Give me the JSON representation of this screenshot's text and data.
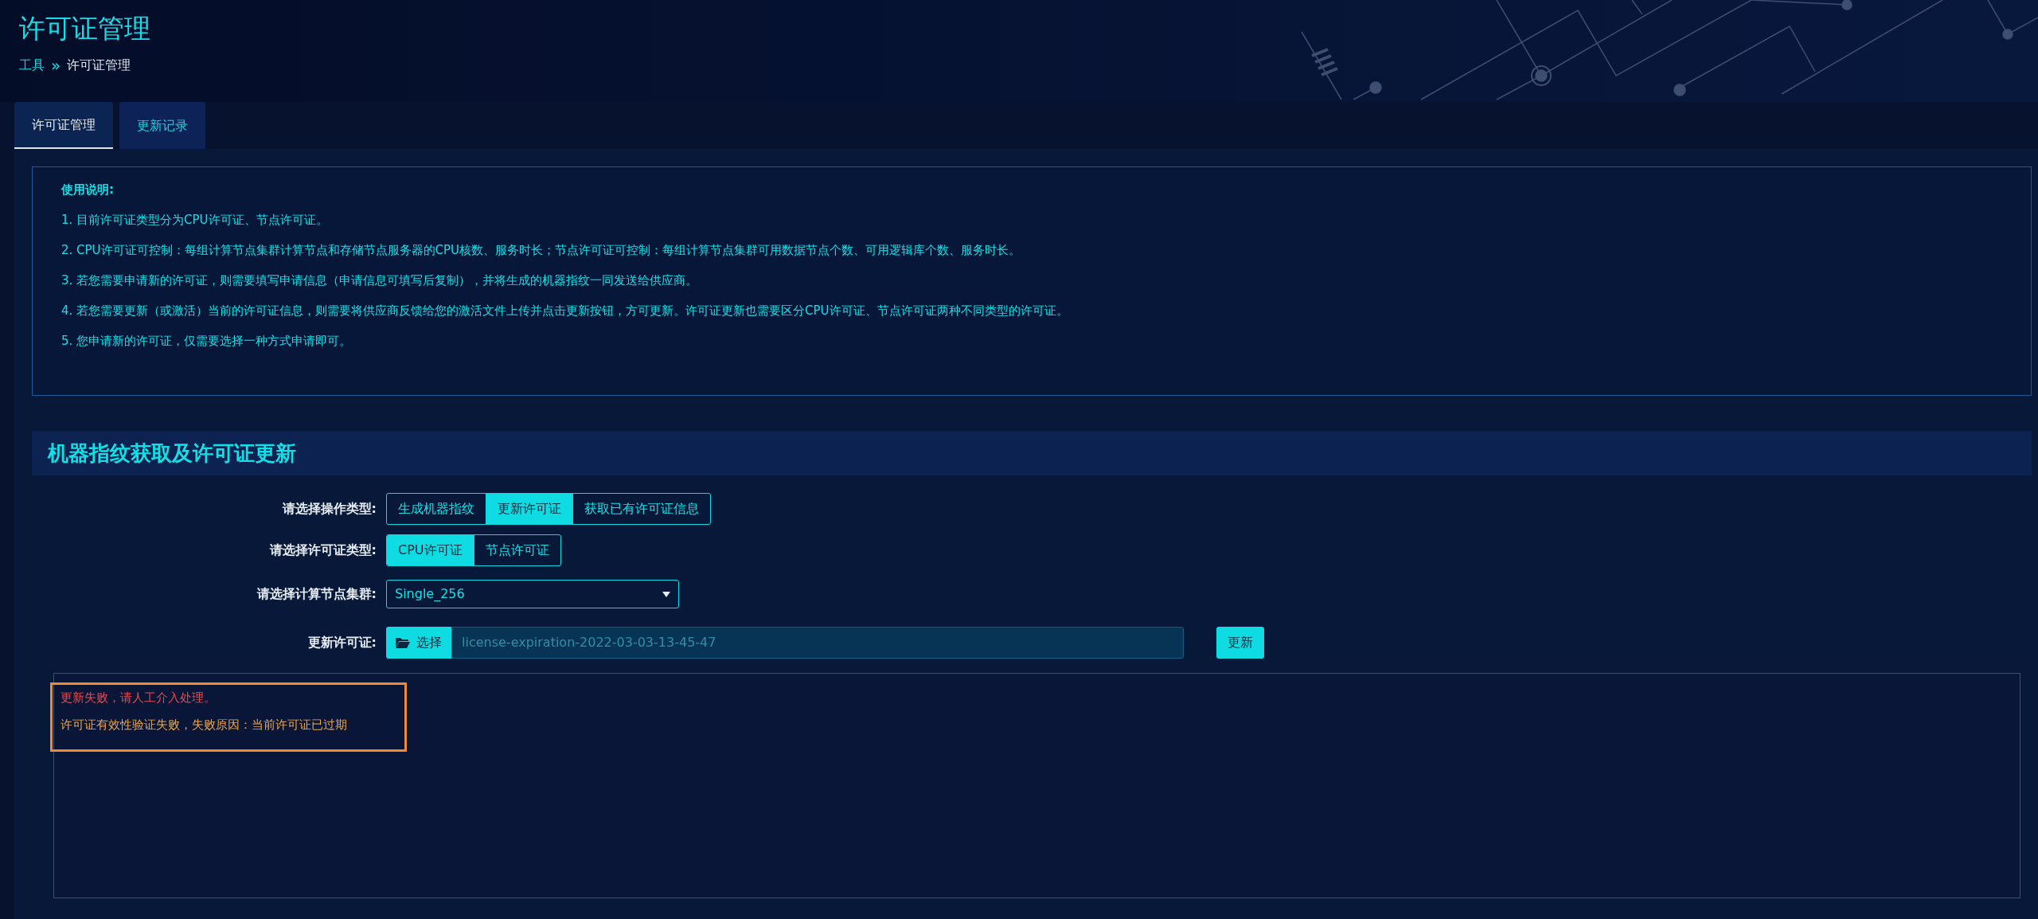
{
  "page": {
    "title": "许可证管理"
  },
  "breadcrumb": [
    {
      "text": "工具",
      "kind": "link"
    },
    {
      "text": "»",
      "kind": "separator"
    },
    {
      "text": "许可证管理",
      "kind": "current"
    }
  ],
  "tabs": [
    {
      "label": "许可证管理",
      "selected": true
    },
    {
      "label": "更新记录",
      "selected": false
    }
  ],
  "instructions": {
    "title": "使用说明:",
    "items": [
      "1. 目前许可证类型分为CPU许可证、节点许可证。",
      "2. CPU许可证可控制：每组计算节点集群计算节点和存储节点服务器的CPU核数、服务时长；节点许可证可控制：每组计算节点集群可用数据节点个数、可用逻辑库个数、服务时长。",
      "3. 若您需要申请新的许可证，则需要填写申请信息（申请信息可填写后复制），并将生成的机器指纹一同发送给供应商。",
      "4. 若您需要更新（或激活）当前的许可证信息，则需要将供应商反馈给您的激活文件上传并点击更新按钮，方可更新。许可证更新也需要区分CPU许可证、节点许可证两种不同类型的许可证。",
      "5. 您申请新的许可证，仅需要选择一种方式申请即可。"
    ]
  },
  "section": {
    "title": "机器指纹获取及许可证更新",
    "fields": [
      {
        "kind": "segmented",
        "label": "请选择操作类型:",
        "options": [
          {
            "label": "生成机器指纹",
            "selected": false
          },
          {
            "label": "更新许可证",
            "selected": true
          },
          {
            "label": "获取已有许可证信息",
            "selected": false
          }
        ]
      },
      {
        "kind": "segmented",
        "label": "请选择许可证类型:",
        "options": [
          {
            "label": "CPU许可证",
            "selected": true
          },
          {
            "label": "节点许可证",
            "selected": false
          }
        ]
      },
      {
        "kind": "select",
        "label": "请选择计算节点集群:",
        "value": "Single_256"
      },
      {
        "kind": "file",
        "label": "更新许可证:",
        "button": "选择",
        "value": "license-expiration-2022-03-03-13-45-47",
        "action": "更新"
      }
    ],
    "messages": [
      {
        "text": "更新失败，请人工介入处理。",
        "color": "#e8484f"
      },
      {
        "text": "许可证有效性验证失败，失败原因：当前许可证已过期",
        "color": "#eaa64a"
      }
    ]
  }
}
